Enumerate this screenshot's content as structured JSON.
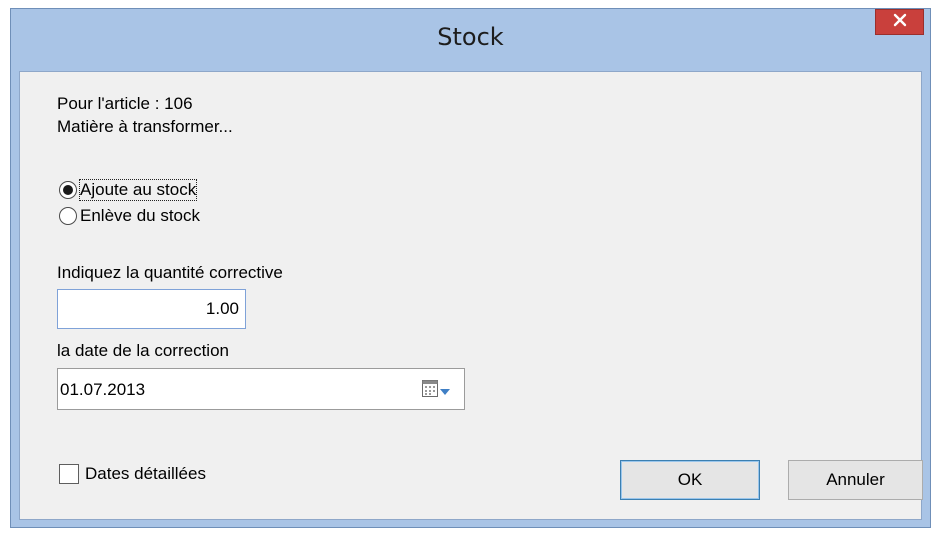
{
  "window": {
    "title": "Stock",
    "close_label": "✕"
  },
  "info": {
    "article_line": "Pour l'article : 106",
    "description_line": "Matière à transformer..."
  },
  "options": {
    "add_label": "Ajoute au stock",
    "add_selected": true,
    "remove_label": "Enlève du stock",
    "remove_selected": false
  },
  "quantity": {
    "label": "Indiquez la quantité corrective",
    "value": "1.00"
  },
  "date": {
    "label": "la date de la correction",
    "value": "01.07.2013"
  },
  "detailed_dates": {
    "label": "Dates détaillées",
    "checked": false
  },
  "buttons": {
    "ok_label": "OK",
    "cancel_label": "Annuler"
  },
  "colors": {
    "titlebar": "#a9c4e6",
    "close_button": "#c9403c",
    "client_background": "#f0f0f0",
    "textbox_border": "#7fa2d8"
  },
  "icons": {
    "calendar": "calendar-icon",
    "dropdown": "chevron-down-icon",
    "close": "close-icon"
  }
}
